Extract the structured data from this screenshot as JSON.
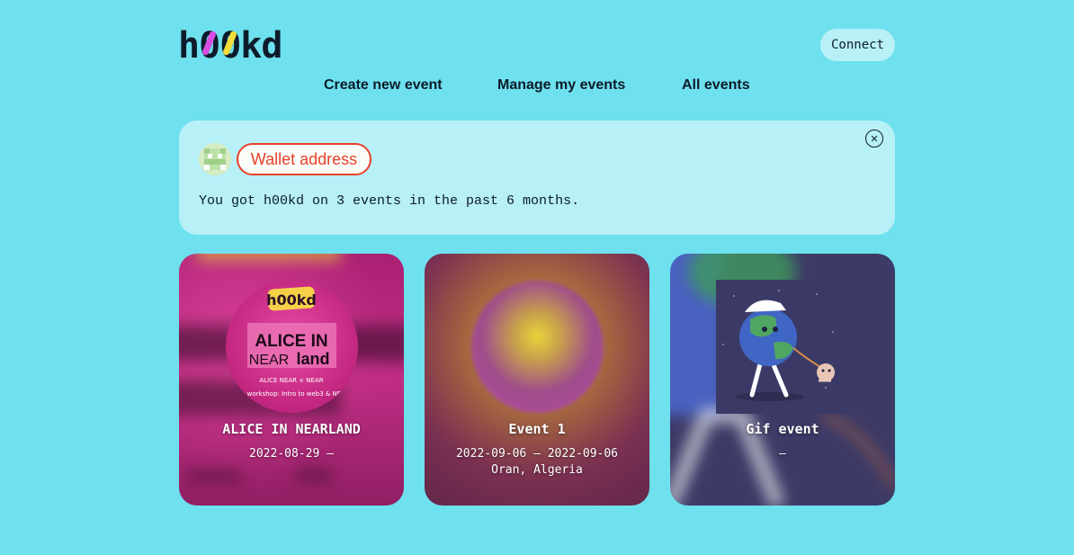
{
  "app": {
    "logo_parts": [
      "h",
      "0",
      "0",
      "kd"
    ],
    "logo_slash_colors": [
      "#d84ee0",
      "#f2de3c"
    ]
  },
  "header": {
    "connect_label": "Connect"
  },
  "nav": {
    "items": [
      {
        "label": "Create new event"
      },
      {
        "label": "Manage my events"
      },
      {
        "label": "All events"
      }
    ]
  },
  "profile": {
    "wallet_label": "Wallet address",
    "summary": "You got h00kd on 3 events in the past 6 months.",
    "close_icon": "close-icon",
    "avatar_icon": "pixel-avatar-icon"
  },
  "events": [
    {
      "title": "ALICE IN NEARLAND",
      "date": "2022-08-29 –",
      "location": "",
      "image_text": {
        "brand": "h00kd",
        "line1": "ALICE IN",
        "line2_a": "NEAR",
        "line2_b": "land",
        "partners": "ALICE NEAR × NEAR",
        "ring": "Edu workshop: Intro to web3 & NEAR"
      },
      "colors": {
        "bg": "#b4237a",
        "accent": "#e8419a"
      }
    },
    {
      "title": "Event 1",
      "date": "2022-09-06 – 2022-09-06",
      "location": "Oran, Algeria",
      "colors": {
        "bg": "#6a2a52",
        "accent": "#e2c24a"
      }
    },
    {
      "title": "Gif event",
      "date": "–",
      "location": "",
      "colors": {
        "bg": "#3b3a66",
        "accent": "#4a5fbd"
      }
    }
  ]
}
